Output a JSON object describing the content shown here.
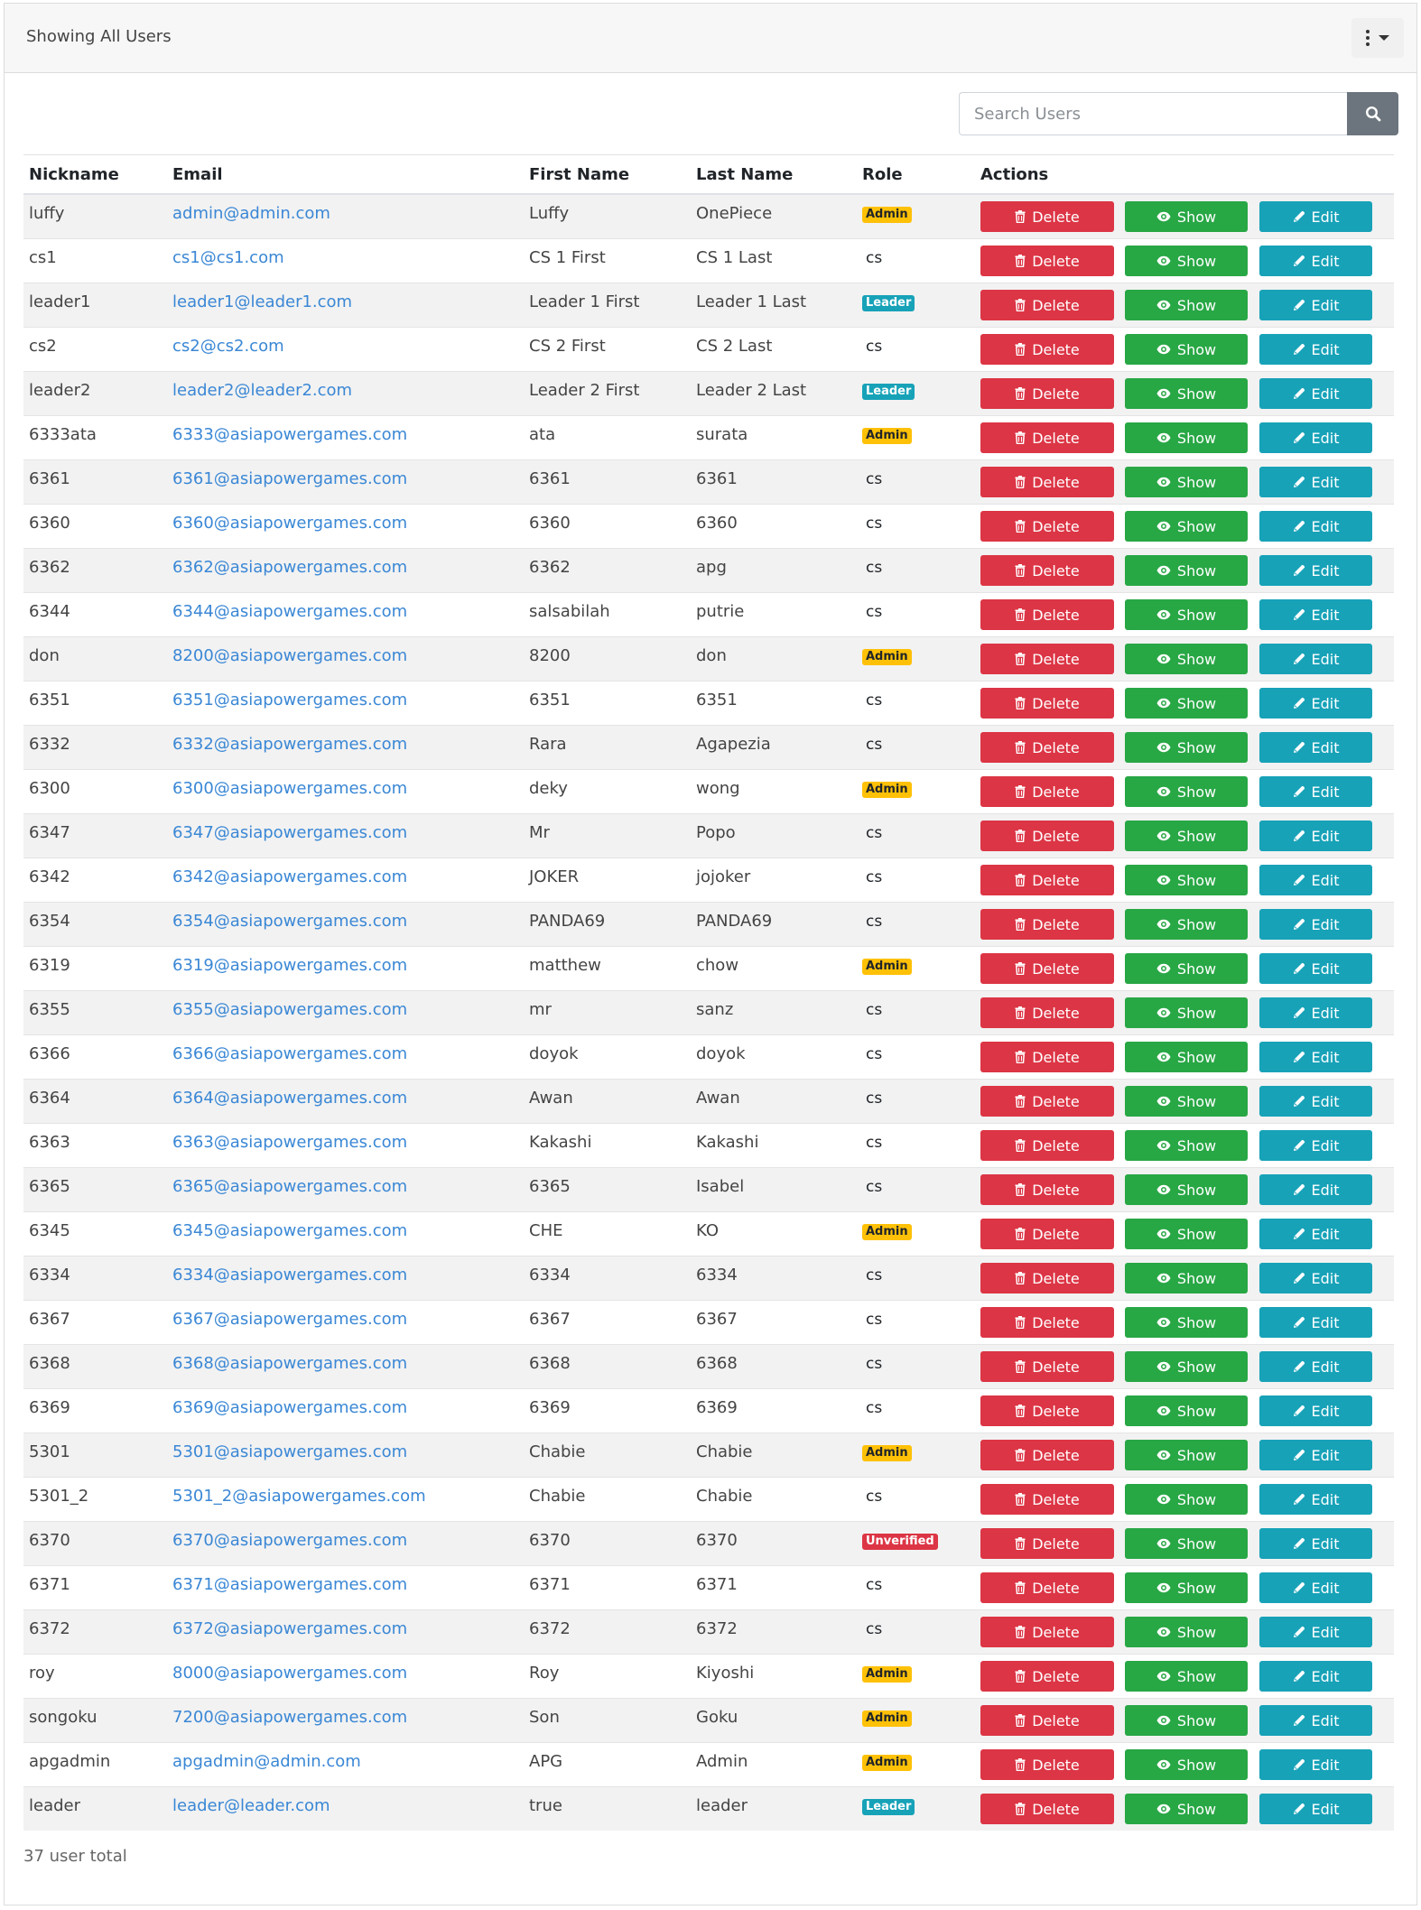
{
  "header": {
    "title": "Showing All Users"
  },
  "search": {
    "placeholder": "Search Users"
  },
  "columns": {
    "nickname": "Nickname",
    "email": "Email",
    "first_name": "First Name",
    "last_name": "Last Name",
    "role": "Role",
    "actions": "Actions"
  },
  "action_labels": {
    "delete": "Delete",
    "show": "Show",
    "edit": "Edit"
  },
  "role_colors": {
    "Admin": "#ffc107",
    "Leader": "#17a2b8",
    "Unverified": "#dc3545"
  },
  "users": [
    {
      "nickname": "luffy",
      "email": "admin@admin.com",
      "first_name": "Luffy",
      "last_name": "OnePiece",
      "role": "Admin"
    },
    {
      "nickname": "cs1",
      "email": "cs1@cs1.com",
      "first_name": "CS 1 First",
      "last_name": "CS 1 Last",
      "role": "cs"
    },
    {
      "nickname": "leader1",
      "email": "leader1@leader1.com",
      "first_name": "Leader 1 First",
      "last_name": "Leader 1 Last",
      "role": "Leader"
    },
    {
      "nickname": "cs2",
      "email": "cs2@cs2.com",
      "first_name": "CS 2 First",
      "last_name": "CS 2 Last",
      "role": "cs"
    },
    {
      "nickname": "leader2",
      "email": "leader2@leader2.com",
      "first_name": "Leader 2 First",
      "last_name": "Leader 2 Last",
      "role": "Leader"
    },
    {
      "nickname": "6333ata",
      "email": "6333@asiapowergames.com",
      "first_name": "ata",
      "last_name": "surata",
      "role": "Admin"
    },
    {
      "nickname": "6361",
      "email": "6361@asiapowergames.com",
      "first_name": "6361",
      "last_name": "6361",
      "role": "cs"
    },
    {
      "nickname": "6360",
      "email": "6360@asiapowergames.com",
      "first_name": "6360",
      "last_name": "6360",
      "role": "cs"
    },
    {
      "nickname": "6362",
      "email": "6362@asiapowergames.com",
      "first_name": "6362",
      "last_name": "apg",
      "role": "cs"
    },
    {
      "nickname": "6344",
      "email": "6344@asiapowergames.com",
      "first_name": "salsabilah",
      "last_name": "putrie",
      "role": "cs"
    },
    {
      "nickname": "don",
      "email": "8200@asiapowergames.com",
      "first_name": "8200",
      "last_name": "don",
      "role": "Admin"
    },
    {
      "nickname": "6351",
      "email": "6351@asiapowergames.com",
      "first_name": "6351",
      "last_name": "6351",
      "role": "cs"
    },
    {
      "nickname": "6332",
      "email": "6332@asiapowergames.com",
      "first_name": "Rara",
      "last_name": "Agapezia",
      "role": "cs"
    },
    {
      "nickname": "6300",
      "email": "6300@asiapowergames.com",
      "first_name": "deky",
      "last_name": "wong",
      "role": "Admin"
    },
    {
      "nickname": "6347",
      "email": "6347@asiapowergames.com",
      "first_name": "Mr",
      "last_name": "Popo",
      "role": "cs"
    },
    {
      "nickname": "6342",
      "email": "6342@asiapowergames.com",
      "first_name": "JOKER",
      "last_name": "jojoker",
      "role": "cs"
    },
    {
      "nickname": "6354",
      "email": "6354@asiapowergames.com",
      "first_name": "PANDA69",
      "last_name": "PANDA69",
      "role": "cs"
    },
    {
      "nickname": "6319",
      "email": "6319@asiapowergames.com",
      "first_name": "matthew",
      "last_name": "chow",
      "role": "Admin"
    },
    {
      "nickname": "6355",
      "email": "6355@asiapowergames.com",
      "first_name": "mr",
      "last_name": "sanz",
      "role": "cs"
    },
    {
      "nickname": "6366",
      "email": "6366@asiapowergames.com",
      "first_name": "doyok",
      "last_name": "doyok",
      "role": "cs"
    },
    {
      "nickname": "6364",
      "email": "6364@asiapowergames.com",
      "first_name": "Awan",
      "last_name": "Awan",
      "role": "cs"
    },
    {
      "nickname": "6363",
      "email": "6363@asiapowergames.com",
      "first_name": "Kakashi",
      "last_name": "Kakashi",
      "role": "cs"
    },
    {
      "nickname": "6365",
      "email": "6365@asiapowergames.com",
      "first_name": "6365",
      "last_name": "Isabel",
      "role": "cs"
    },
    {
      "nickname": "6345",
      "email": "6345@asiapowergames.com",
      "first_name": "CHE",
      "last_name": "KO",
      "role": "Admin"
    },
    {
      "nickname": "6334",
      "email": "6334@asiapowergames.com",
      "first_name": "6334",
      "last_name": "6334",
      "role": "cs"
    },
    {
      "nickname": "6367",
      "email": "6367@asiapowergames.com",
      "first_name": "6367",
      "last_name": "6367",
      "role": "cs"
    },
    {
      "nickname": "6368",
      "email": "6368@asiapowergames.com",
      "first_name": "6368",
      "last_name": "6368",
      "role": "cs"
    },
    {
      "nickname": "6369",
      "email": "6369@asiapowergames.com",
      "first_name": "6369",
      "last_name": "6369",
      "role": "cs"
    },
    {
      "nickname": "5301",
      "email": "5301@asiapowergames.com",
      "first_name": "Chabie",
      "last_name": "Chabie",
      "role": "Admin"
    },
    {
      "nickname": "5301_2",
      "email": "5301_2@asiapowergames.com",
      "first_name": "Chabie",
      "last_name": "Chabie",
      "role": "cs"
    },
    {
      "nickname": "6370",
      "email": "6370@asiapowergames.com",
      "first_name": "6370",
      "last_name": "6370",
      "role": "Unverified"
    },
    {
      "nickname": "6371",
      "email": "6371@asiapowergames.com",
      "first_name": "6371",
      "last_name": "6371",
      "role": "cs"
    },
    {
      "nickname": "6372",
      "email": "6372@asiapowergames.com",
      "first_name": "6372",
      "last_name": "6372",
      "role": "cs"
    },
    {
      "nickname": "roy",
      "email": "8000@asiapowergames.com",
      "first_name": "Roy",
      "last_name": "Kiyoshi",
      "role": "Admin"
    },
    {
      "nickname": "songoku",
      "email": "7200@asiapowergames.com",
      "first_name": "Son",
      "last_name": "Goku",
      "role": "Admin"
    },
    {
      "nickname": "apgadmin",
      "email": "apgadmin@admin.com",
      "first_name": "APG",
      "last_name": "Admin",
      "role": "Admin"
    },
    {
      "nickname": "leader",
      "email": "leader@leader.com",
      "first_name": "true",
      "last_name": "leader",
      "role": "Leader"
    }
  ],
  "footer": {
    "total": "37 user total"
  }
}
